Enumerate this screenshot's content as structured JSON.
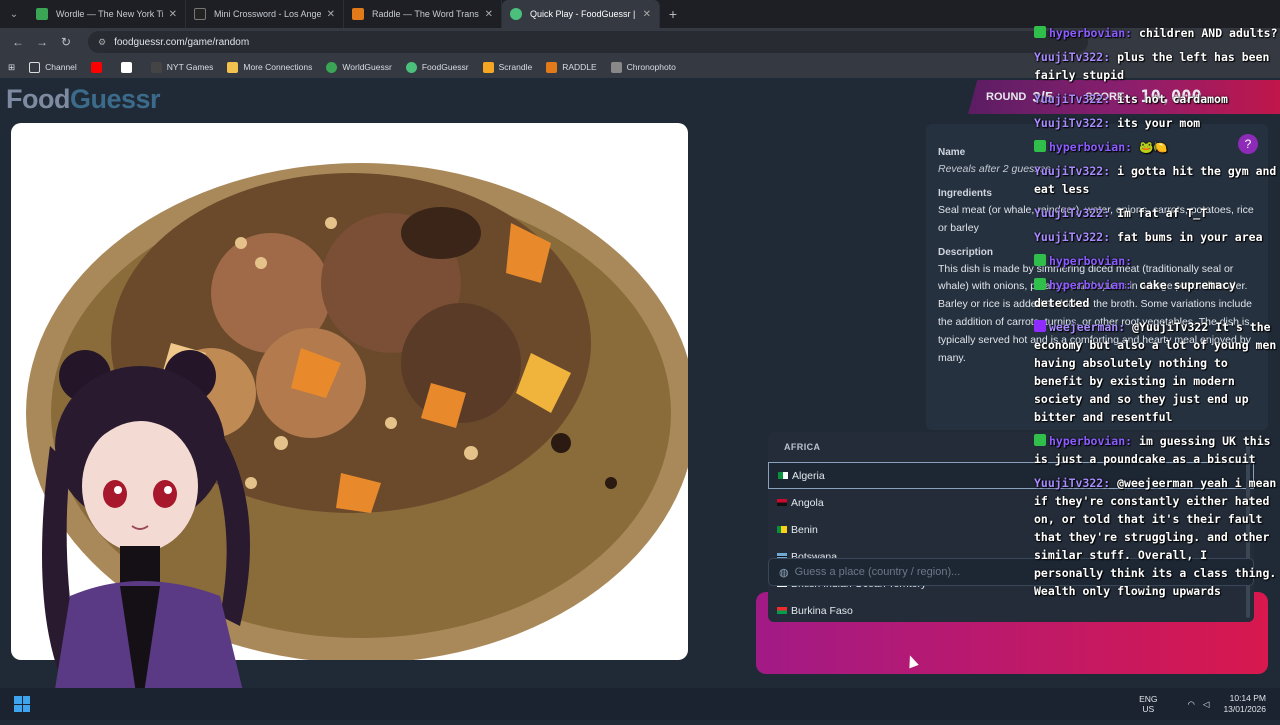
{
  "tabs": [
    {
      "title": "Wordle — The New York Times",
      "color": "#3aa655"
    },
    {
      "title": "Mini Crossword - Los Angeles T",
      "color": "#222222"
    },
    {
      "title": "Raddle — The Word Transform",
      "color": "#e27a1a"
    },
    {
      "title": "Quick Play - FoodGuessr | Food",
      "color": "#4bc07c"
    }
  ],
  "address": {
    "url": "foodguessr.com/game/random"
  },
  "bookmarks": [
    {
      "label": "Channel",
      "color": "#e0e0e0"
    },
    {
      "label": "",
      "color": "#ff0000"
    },
    {
      "label": "",
      "color": "#ffffff"
    },
    {
      "label": "NYT Games",
      "color": "#333333"
    },
    {
      "label": "More Connections",
      "color": "#f2c14e"
    },
    {
      "label": "WorldGuessr",
      "color": "#3aa655"
    },
    {
      "label": "FoodGuessr",
      "color": "#4bc07c"
    },
    {
      "label": "Scrandle",
      "color": "#f5a623"
    },
    {
      "label": "RADDLE",
      "color": "#e27a1a"
    },
    {
      "label": "Chronophoto",
      "color": "#888888"
    }
  ],
  "logo": {
    "part1": "Food",
    "part2": "Guessr"
  },
  "round": {
    "label": "ROUND",
    "value": "3/5",
    "score_label": "SCORE",
    "score": "10,000"
  },
  "info": {
    "name_label": "Name",
    "name_value": "Reveals after 2 guesses",
    "ingredients_label": "Ingredients",
    "ingredients_value": "Seal meat (or whale, reindeer), water, onions, carrots, potatoes, rice or barley",
    "description_label": "Description",
    "description_value": "This dish is made by simmering diced meat (traditionally seal or whale) with onions, potatoes, and spices in a large pot until tender. Barley or rice is added to thicken the broth. Some variations include the addition of carrots, turnips, or other root vegetables. The dish is typically served hot and is a comforting and hearty meal enjoyed by many."
  },
  "dropdown": {
    "region": "AFRICA",
    "options": [
      "Algeria",
      "Angola",
      "Benin",
      "Botswana",
      "British Indian Ocean Territory",
      "Burkina Faso"
    ]
  },
  "guess": {
    "placeholder": "Guess a place (country / region)..."
  },
  "chat": [
    {
      "user": "hyperbovian:",
      "text": "children AND adults?",
      "badge": "green"
    },
    {
      "user": "YuujiTv322:",
      "text": "plus the left has been fairly stupid",
      "badge": ""
    },
    {
      "user": "YuujiTv322:",
      "text": "its not cardamom",
      "badge": ""
    },
    {
      "user": "YuujiTv322:",
      "text": "its your mom",
      "badge": ""
    },
    {
      "user": "hyperbovian:",
      "text": "🐸🍋",
      "badge": "green"
    },
    {
      "user": "YuujiTv322:",
      "text": "i gotta hit the gym and eat less",
      "badge": ""
    },
    {
      "user": "YuujiTv322:",
      "text": "Im fat af T_T",
      "badge": ""
    },
    {
      "user": "YuujiTv322:",
      "text": "fat bums in your area",
      "badge": ""
    },
    {
      "user": "hyperbovian:",
      "text": "",
      "badge": "green"
    },
    {
      "user": "hyperbovian:",
      "text": "cake supremacy detected",
      "badge": "green"
    },
    {
      "user": "weejeerman:",
      "text": "@YuujiTv322 It's the economy but also a lot of young men having absolutely nothing to benefit by existing in modern society and so they just end up bitter and resentful",
      "badge": "purple"
    },
    {
      "user": "hyperbovian:",
      "text": "im guessing UK this is just a poundcake as a biscuit",
      "badge": "green"
    },
    {
      "user": "YuujiTv322:",
      "text": "@weejeerman yeah i mean if they're constantly either hated on, or told that it's their fault that they're struggling. and other similar stuff. Overall, I personally think its a class thing. Wealth only flowing upwards",
      "badge": ""
    }
  ],
  "taskbar": {
    "lang_top": "ENG",
    "lang_bottom": "US",
    "time": "10:14 PM",
    "date": "13/01/2026"
  }
}
